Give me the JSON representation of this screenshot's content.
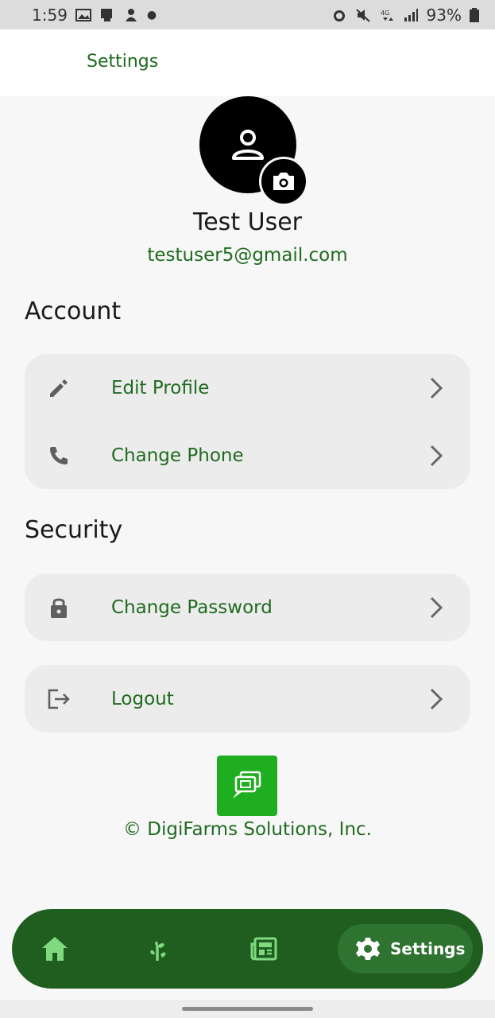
{
  "status_bar": {
    "time": "1:59",
    "battery": "93%"
  },
  "app_bar": {
    "title": "Settings"
  },
  "profile": {
    "name": "Test User",
    "email": "testuser5@gmail.com"
  },
  "sections": {
    "account": {
      "title": "Account",
      "items": [
        {
          "label": "Edit Profile",
          "icon": "pencil-icon"
        },
        {
          "label": "Change Phone",
          "icon": "phone-icon"
        }
      ]
    },
    "security": {
      "title": "Security",
      "items": [
        {
          "label": "Change Password",
          "icon": "lock-icon"
        }
      ]
    },
    "logout": {
      "label": "Logout",
      "icon": "logout-icon"
    }
  },
  "footer": {
    "copyright": "©  DigiFarms Solutions, Inc."
  },
  "bottom_nav": {
    "items": [
      {
        "icon": "home-icon"
      },
      {
        "icon": "plant-icon"
      },
      {
        "icon": "news-icon"
      },
      {
        "icon": "gear-icon",
        "label": "Settings",
        "active": true
      }
    ]
  },
  "colors": {
    "brand_green": "#1f6b1f",
    "nav_bg": "#1f5e1f",
    "nav_active_bg": "#2f7331",
    "logo_green": "#1fae1f",
    "nav_icon": "#7fd97f"
  }
}
